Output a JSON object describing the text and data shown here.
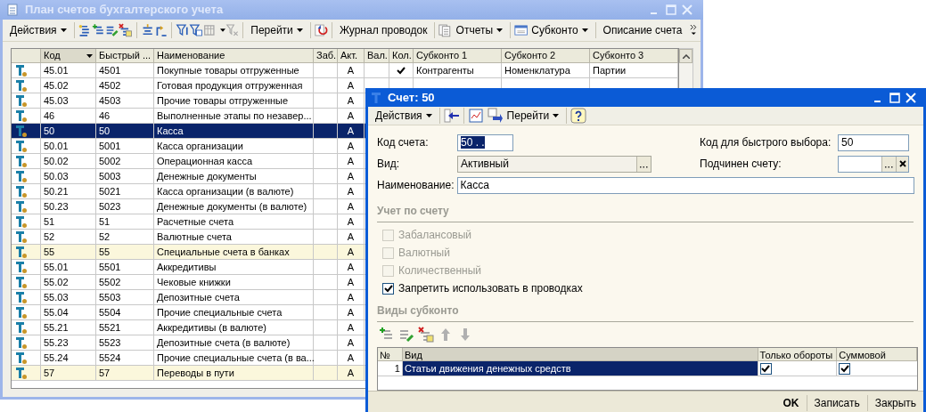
{
  "main_window": {
    "title": "План счетов бухгалтерского учета",
    "toolbar": [
      {
        "label": "Действия",
        "dropdown": true
      },
      {
        "label": "Перейти",
        "dropdown": true
      },
      {
        "label": "Журнал проводок",
        "dropdown": false
      },
      {
        "label": "Отчеты",
        "dropdown": true
      },
      {
        "label": "Субконто",
        "dropdown": true
      },
      {
        "label": "Описание счета",
        "dropdown": false
      }
    ],
    "table": {
      "columns": [
        {
          "label": "Код",
          "sorted": true
        },
        {
          "label": "Быстрый ...",
          "sorted": false
        },
        {
          "label": "Наименование",
          "sorted": false
        },
        {
          "label": "Заб.",
          "sorted": false
        },
        {
          "label": "Акт.",
          "sorted": false
        },
        {
          "label": "Вал.",
          "sorted": false
        },
        {
          "label": "Кол.",
          "sorted": false
        },
        {
          "label": "Субконто 1",
          "sorted": false
        },
        {
          "label": "Субконто 2",
          "sorted": false
        },
        {
          "label": "Субконто 3",
          "sorted": false
        }
      ],
      "rows": [
        {
          "code": "45.01",
          "quick": "4501",
          "name": "Покупные товары отгруженные",
          "type": "А",
          "quantity": true,
          "subconto": [
            "Контрагенты",
            "Номенклатура",
            "Партии"
          ],
          "selected": false,
          "highlighted": false
        },
        {
          "code": "45.02",
          "quick": "4502",
          "name": "Готовая продукция отгруженная",
          "type": "А",
          "selected": false,
          "highlighted": false
        },
        {
          "code": "45.03",
          "quick": "4503",
          "name": "Прочие товары отгруженные",
          "type": "А",
          "selected": false,
          "highlighted": false
        },
        {
          "code": "46",
          "quick": "46",
          "name": "Выполненные этапы по незавер...",
          "type": "А",
          "selected": false,
          "highlighted": false
        },
        {
          "code": "50",
          "quick": "50",
          "name": "Касса",
          "type": "А",
          "selected": true
        },
        {
          "code": "50.01",
          "quick": "5001",
          "name": "Касса организации",
          "type": "А",
          "selected": false,
          "highlighted": false
        },
        {
          "code": "50.02",
          "quick": "5002",
          "name": "Операционная касса",
          "type": "А",
          "selected": false,
          "highlighted": false
        },
        {
          "code": "50.03",
          "quick": "5003",
          "name": "Денежные документы",
          "type": "А",
          "selected": false,
          "highlighted": false
        },
        {
          "code": "50.21",
          "quick": "5021",
          "name": "Касса организации (в валюте)",
          "type": "А",
          "selected": false,
          "highlighted": false
        },
        {
          "code": "50.23",
          "quick": "5023",
          "name": "Денежные документы (в валюте)",
          "type": "А",
          "selected": false,
          "highlighted": false
        },
        {
          "code": "51",
          "quick": "51",
          "name": "Расчетные счета",
          "type": "А",
          "selected": false,
          "highlighted": false
        },
        {
          "code": "52",
          "quick": "52",
          "name": "Валютные счета",
          "type": "А",
          "selected": false,
          "highlighted": false
        },
        {
          "code": "55",
          "quick": "55",
          "name": "Специальные счета в банках",
          "type": "А",
          "selected": false,
          "highlighted": true
        },
        {
          "code": "55.01",
          "quick": "5501",
          "name": "Аккредитивы",
          "type": "А",
          "selected": false,
          "highlighted": false
        },
        {
          "code": "55.02",
          "quick": "5502",
          "name": "Чековые книжки",
          "type": "А",
          "selected": false,
          "highlighted": false
        },
        {
          "code": "55.03",
          "quick": "5503",
          "name": "Депозитные счета",
          "type": "А",
          "selected": false,
          "highlighted": false
        },
        {
          "code": "55.04",
          "quick": "5504",
          "name": "Прочие специальные счета",
          "type": "А",
          "selected": false,
          "highlighted": false
        },
        {
          "code": "55.21",
          "quick": "5521",
          "name": "Аккредитивы (в валюте)",
          "type": "А",
          "selected": false,
          "highlighted": false
        },
        {
          "code": "55.23",
          "quick": "5523",
          "name": "Депозитные счета (в валюте)",
          "type": "А",
          "selected": false,
          "highlighted": false
        },
        {
          "code": "55.24",
          "quick": "5524",
          "name": "Прочие специальные счета (в ва...",
          "type": "А",
          "selected": false,
          "highlighted": false
        },
        {
          "code": "57",
          "quick": "57",
          "name": "Переводы в пути",
          "type": "А",
          "selected": false,
          "highlighted": true
        }
      ]
    }
  },
  "dialog": {
    "title": "Счет: 50",
    "toolbar": [
      {
        "label": "Действия",
        "dropdown": true
      },
      {
        "label": "Перейти",
        "dropdown": true
      }
    ],
    "fields": {
      "code": {
        "label": "Код счета:",
        "value": "50 . ."
      },
      "quick_code": {
        "label": "Код для быстрого выбора:",
        "value": "50"
      },
      "kind": {
        "label": "Вид:",
        "value": "Активный"
      },
      "parent": {
        "label": "Подчинен счету:"
      },
      "name": {
        "label": "Наименование:",
        "value": "Касса"
      }
    },
    "accounting_title": "Учет по счету",
    "checkboxes": [
      {
        "label": "Забалансовый",
        "checked": false,
        "disabled": true
      },
      {
        "label": "Валютный",
        "checked": false,
        "disabled": true
      },
      {
        "label": "Количественный",
        "checked": false,
        "disabled": true
      },
      {
        "label": "Запретить использовать в проводках",
        "checked": true,
        "disabled": false
      }
    ],
    "subconto_title": "Виды субконто",
    "subconto_table": {
      "columns": [
        "№",
        "Вид",
        "Только обороты",
        "Суммовой"
      ],
      "rows": [
        {
          "number": "1",
          "name": "Статьи движения денежных средств",
          "turnover_only": true,
          "sum": true,
          "selected": true
        }
      ]
    },
    "buttons": [
      {
        "label": "OK",
        "default": true
      },
      {
        "label": "Записать",
        "default": false
      },
      {
        "label": "Закрыть",
        "default": false
      }
    ]
  }
}
